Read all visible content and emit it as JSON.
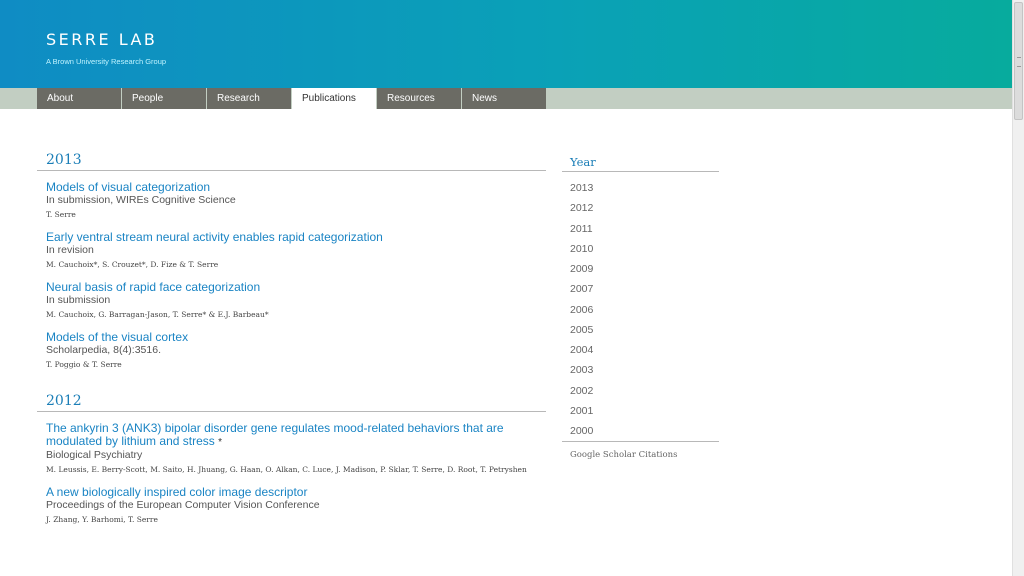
{
  "header": {
    "title": "SERRE LAB",
    "subtitle": "A Brown University Research Group"
  },
  "nav": {
    "tabs": [
      {
        "label": "About",
        "active": false
      },
      {
        "label": "People",
        "active": false
      },
      {
        "label": "Research",
        "active": false
      },
      {
        "label": "Publications",
        "active": true
      },
      {
        "label": "Resources",
        "active": false
      },
      {
        "label": "News",
        "active": false
      }
    ]
  },
  "main": {
    "years": [
      {
        "year": "2013",
        "pubs": [
          {
            "title": "Models of visual categorization",
            "venue": "In submission, WIREs Cognitive Science",
            "authors": "T. Serre"
          },
          {
            "title": "Early ventral stream neural activity enables rapid categorization",
            "venue": "In revision",
            "authors": "M. Cauchoix*, S. Crouzet*, D. Fize & T. Serre"
          },
          {
            "title": "Neural basis of rapid face categorization",
            "venue": "In submission",
            "authors": "M. Cauchoix, G. Barragan-Jason, T. Serre* & E.J. Barbeau*"
          },
          {
            "title": "Models of the visual cortex",
            "venue": "Scholarpedia, 8(4):3516.",
            "authors": "T. Poggio & T. Serre"
          }
        ]
      },
      {
        "year": "2012",
        "pubs": [
          {
            "title": "The ankyrin 3 (ANK3) bipolar disorder gene regulates mood-related behaviors that are modulated by lithium and stress",
            "title_marker": "*",
            "venue": "Biological Psychiatry",
            "authors": "M. Leussis, E. Berry-Scott, M. Saito, H. Jhuang, G. Haan, O. Alkan, C. Luce, J. Madison, P. Sklar, T. Serre, D. Root, T. Petryshen"
          },
          {
            "title": "A new biologically inspired color image descriptor",
            "venue": "Proceedings of the European Computer Vision Conference",
            "authors": "J. Zhang, Y. Barhomi, T. Serre"
          }
        ]
      }
    ]
  },
  "sidebar": {
    "heading": "Year",
    "years": [
      "2013",
      "2012",
      "2011",
      "2010",
      "2009",
      "2007",
      "2006",
      "2005",
      "2004",
      "2003",
      "2002",
      "2001",
      "2000"
    ],
    "citations_label": "Google Scholar Citations"
  },
  "colors": {
    "header_gradient_start": "#0f8cc4",
    "header_gradient_end": "#07ab9d",
    "link": "#1a84c4",
    "nav_tab": "#6b6b64",
    "nav_strip": "#c2cec2"
  }
}
